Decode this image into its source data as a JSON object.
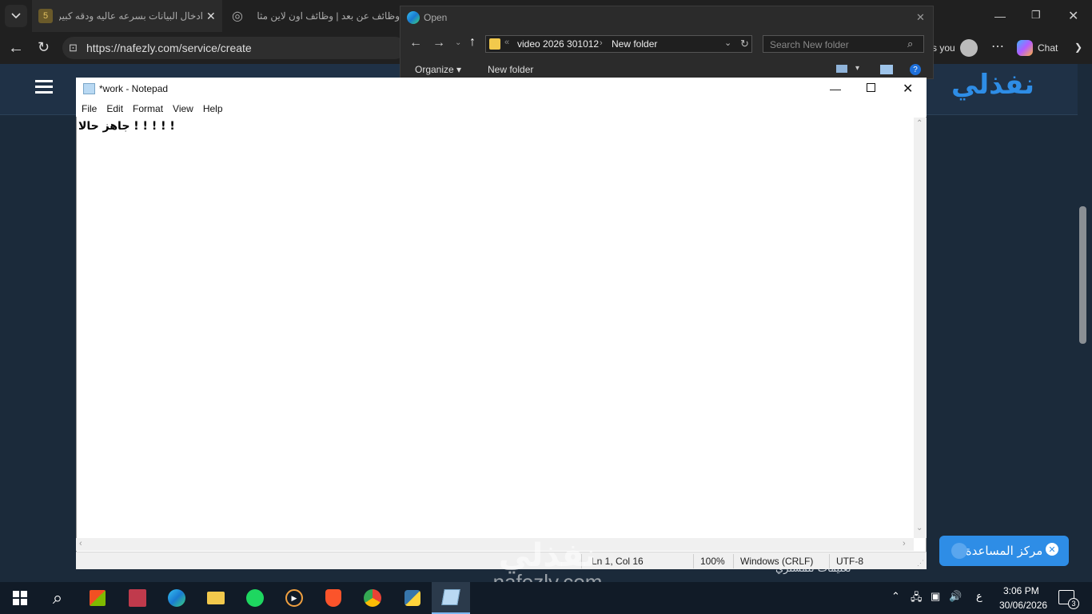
{
  "browser": {
    "tabs": [
      {
        "label": "ادخال البيانات بسرعه عاليه ودقه كبيرة"
      },
      {
        "label": "وظائف عن بعد | وظائف اون لاين مثا"
      }
    ],
    "url": "https://nafezly.com/service/create",
    "profile_label": "s you",
    "chat_label": "Chat"
  },
  "open_dialog": {
    "title": "Open",
    "path": [
      "video 2026 301012",
      "New folder"
    ],
    "search_placeholder": "Search New folder",
    "organize_label": "Organize",
    "new_folder_label": "New folder"
  },
  "notepad": {
    "title": "*work - Notepad",
    "menu": [
      "File",
      "Edit",
      "Format",
      "View",
      "Help"
    ],
    "content": "جاهز حالا  ! ! ! ! !",
    "status": {
      "position": "Ln 1, Col 16",
      "zoom": "100%",
      "line_ending": "Windows (CRLF)",
      "encoding": "UTF-8"
    }
  },
  "page": {
    "logo": "نفذلي",
    "help_center": "مركز المساعدة",
    "behind_text": "تعليمات للمشتري"
  },
  "watermark": {
    "ar": "نفذلي",
    "en": "nafezly.com"
  },
  "taskbar": {
    "time": "3:06 PM",
    "date": "30/06/2026",
    "lang": "ع",
    "notif_count": "3"
  }
}
